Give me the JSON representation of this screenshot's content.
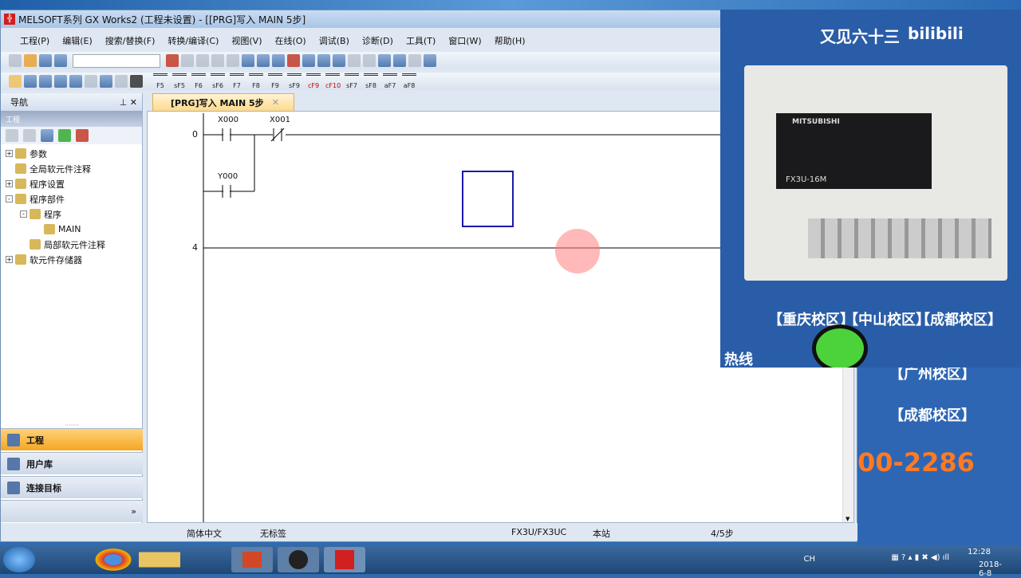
{
  "window": {
    "title": "MELSOFT系列 GX Works2 (工程未设置) - [[PRG]写入 MAIN 5步]",
    "app_icon": "melsoft-icon"
  },
  "menu": [
    "工程(P)",
    "编辑(E)",
    "搜索/替换(F)",
    "转换/编译(C)",
    "视图(V)",
    "在线(O)",
    "调试(B)",
    "诊断(D)",
    "工具(T)",
    "窗口(W)",
    "帮助(H)"
  ],
  "toolbar2_labels": [
    "F5",
    "sF5",
    "F6",
    "sF6",
    "F7",
    "F8",
    "F9",
    "sF9",
    "cF9",
    "cF10",
    "sF7",
    "sF8",
    "aF7",
    "aF8"
  ],
  "navigation": {
    "title": "导航",
    "section": "工程",
    "tree": [
      {
        "label": "参数",
        "level": 0,
        "expand": "+"
      },
      {
        "label": "全局软元件注释",
        "level": 0,
        "expand": ""
      },
      {
        "label": "程序设置",
        "level": 0,
        "expand": "+"
      },
      {
        "label": "程序部件",
        "level": 0,
        "expand": "-"
      },
      {
        "label": "程序",
        "level": 1,
        "expand": "-"
      },
      {
        "label": "MAIN",
        "level": 2,
        "expand": ""
      },
      {
        "label": "局部软元件注释",
        "level": 1,
        "expand": ""
      },
      {
        "label": "软元件存储器",
        "level": 0,
        "expand": "+"
      }
    ],
    "buttons": [
      "工程",
      "用户库",
      "连接目标"
    ],
    "active": "工程"
  },
  "tab": {
    "label": "[PRG]写入 MAIN 5步"
  },
  "ladder": {
    "rungs": [
      {
        "step": "0"
      },
      {
        "step": "4"
      }
    ],
    "contacts": [
      {
        "device": "X000",
        "type": "NO"
      },
      {
        "device": "X001",
        "type": "NC"
      },
      {
        "device": "Y000",
        "type": "NO"
      }
    ]
  },
  "status": {
    "lang": "简体中文",
    "label": "无标签",
    "plc": "FX3U/FX3UC",
    "station": "本站",
    "steps": "4/5步"
  },
  "video": {
    "watermark": "又见六十三",
    "logo": "bilibili",
    "model": "FX3U-16M",
    "brand": "MITSUBISHI",
    "campus1": "【重庆校区】",
    "campus2": "【中山校区】",
    "campus3": "【成都校区】",
    "campus4": "【广州校区】",
    "campus5": "【成都校区】",
    "hotline": "热线",
    "phone": "00-2286"
  },
  "taskbar": {
    "time": "12:28",
    "date": "2018-6-8",
    "ime": "CH"
  },
  "colors": {
    "accent": "#f5a623",
    "cursor": "#1a1aaa",
    "click": "#ff8080"
  }
}
